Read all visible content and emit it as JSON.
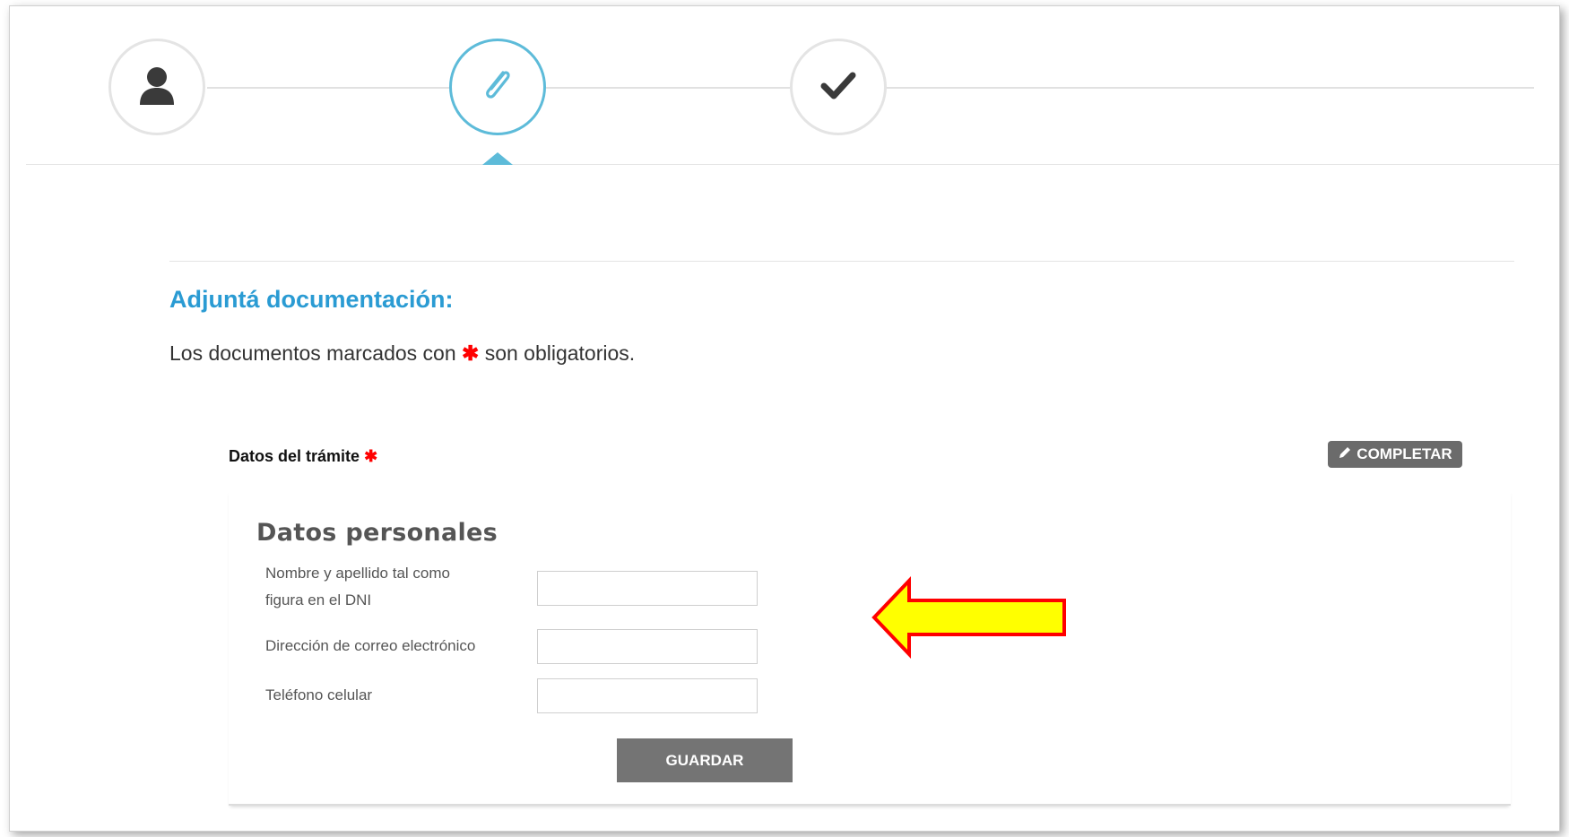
{
  "stepper": {
    "steps": [
      {
        "icon": "user-icon",
        "state": "done"
      },
      {
        "icon": "paperclip-icon",
        "state": "active"
      },
      {
        "icon": "check-icon",
        "state": "pending"
      }
    ]
  },
  "section": {
    "title": "Adjuntá documentación:",
    "desc_before": "Los documentos marcados con",
    "desc_star": "✱",
    "desc_after": "son obligatorios."
  },
  "document": {
    "label": "Datos del trámite",
    "required_star": "✱",
    "complete_label": "COMPLETAR"
  },
  "form": {
    "title": "Datos personales",
    "fields": [
      {
        "label_line1": "Nombre y apellido tal como",
        "label_line2": "figura en el DNI",
        "value": ""
      },
      {
        "label": "Dirección de correo electrónico",
        "value": ""
      },
      {
        "label": "Teléfono celular",
        "value": ""
      }
    ],
    "save_label": "GUARDAR"
  },
  "colors": {
    "accent": "#2a9bd3",
    "step_active": "#5dbbd9",
    "required": "#ff0000",
    "button": "#747474",
    "annotation_fill": "#ffff00",
    "annotation_stroke": "#ff0000"
  }
}
